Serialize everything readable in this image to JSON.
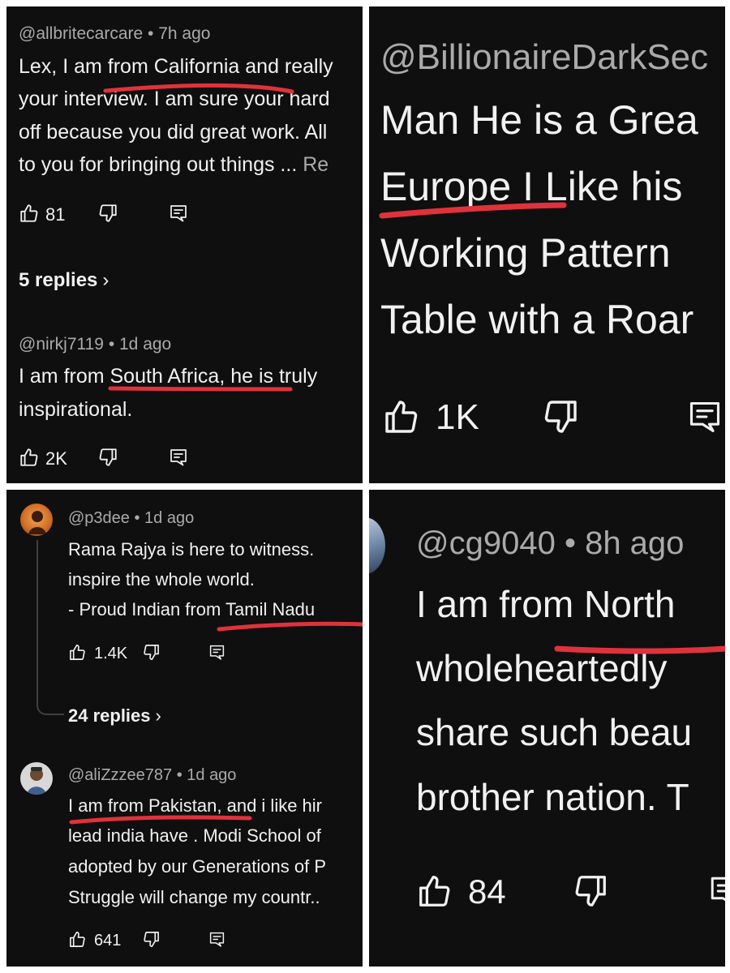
{
  "panels": {
    "top_left": {
      "comment1": {
        "meta": "@allbritecarcare • 7h ago",
        "lines": [
          "Lex, I am from California and really",
          "your interview. I am sure your hard",
          "off because you did great work. All",
          "to you for bringing out things ..."
        ],
        "read_more": "Re",
        "likes": "81"
      },
      "replies": "5 replies",
      "comment2": {
        "meta": "@nirkj7119 • 1d ago",
        "lines": [
          "I am from South Africa, he is truly",
          "inspirational."
        ],
        "likes": "2K"
      }
    },
    "top_right": {
      "meta": "@BillionaireDarkSec",
      "lines": [
        "Man He is a Grea",
        "Europe I Like his",
        "Working Pattern",
        "Table with a Roar"
      ],
      "likes": "1K"
    },
    "bottom_left": {
      "comment1": {
        "meta": "@p3dee • 1d ago",
        "lines": [
          "Rama Rajya is here to witness.",
          "inspire the whole world.",
          "- Proud Indian from Tamil Nadu"
        ],
        "likes": "1.4K"
      },
      "replies": "24 replies",
      "comment2": {
        "meta": "@aliZzzee787 • 1d ago",
        "lines": [
          "I am from Pakistan, and i like hir",
          "lead india have . Modi School of",
          "adopted by our Generations of P",
          "Struggle will change my countr.."
        ],
        "likes": "641"
      }
    },
    "bottom_right": {
      "meta": "@cg9040 • 8h ago",
      "lines": [
        "I am from North",
        "wholeheartedly",
        "share such beau",
        "brother nation. T"
      ],
      "likes": "84"
    }
  },
  "icons": {
    "like": "thumbs-up-icon",
    "dislike": "thumbs-down-icon",
    "reply": "reply-comment-icon",
    "chevron": "chevron-right-icon"
  },
  "colors": {
    "panel_bg": "#0f0f0f",
    "text": "#f1f1f1",
    "meta": "#aaaaaa",
    "underline": "#e0323c",
    "divider": "#ffffff"
  }
}
